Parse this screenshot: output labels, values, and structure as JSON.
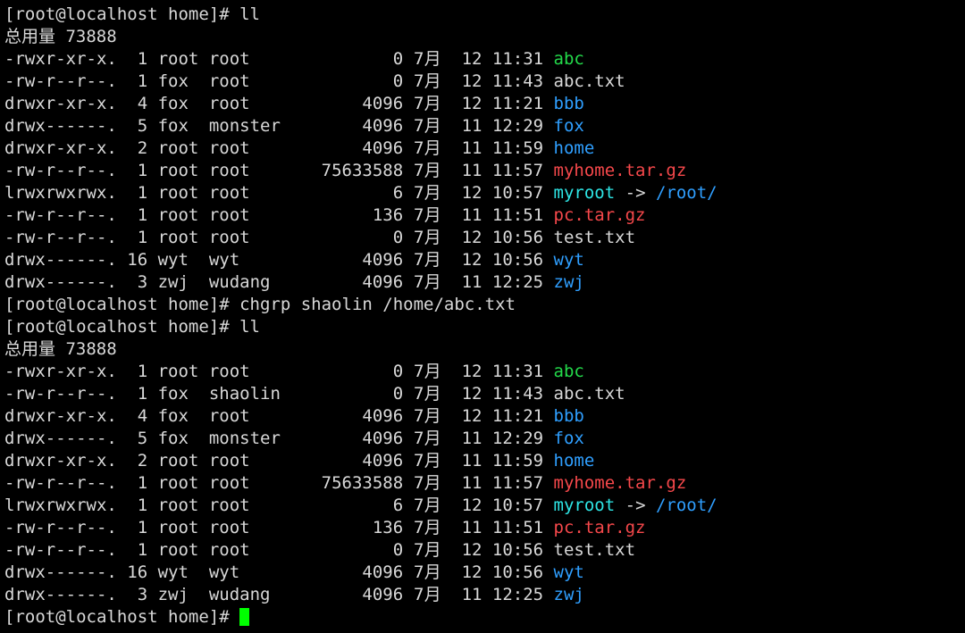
{
  "terminal": {
    "title": "root@localhost:/home",
    "background_color": "#000000",
    "foreground_color": "#d8d8d8",
    "font_size_px": 19,
    "line_height_px": 25,
    "cols": 88,
    "rows": 28,
    "colors": {
      "default": "#d8d8d8",
      "directory": "#2f9fff",
      "executable": "#23d94a",
      "archive": "#f6484b",
      "symlink": "#2ee6e6",
      "cursor": "#00ff00"
    },
    "prompt": "[root@localhost home]#",
    "total_label": "总用量",
    "total_value": "73888",
    "month_label": "7月",
    "link_arrow": "->",
    "commands": [
      "ll",
      "chgrp shaolin /home/abc.txt",
      "ll"
    ],
    "cursor_char": "block"
  },
  "listing_1": {
    "total_line": "总用量 73888",
    "rows": [
      {
        "perms": "-rwxr-xr-x.",
        "links": "1",
        "owner": "root",
        "group": "root",
        "size": "0",
        "month": "7月",
        "day": "12",
        "time": "11:31",
        "name": "abc",
        "color": "executable",
        "target": ""
      },
      {
        "perms": "-rw-r--r--.",
        "links": "1",
        "owner": "fox",
        "group": "root",
        "size": "0",
        "month": "7月",
        "day": "12",
        "time": "11:43",
        "name": "abc.txt",
        "color": "default",
        "target": ""
      },
      {
        "perms": "drwxr-xr-x.",
        "links": "4",
        "owner": "fox",
        "group": "root",
        "size": "4096",
        "month": "7月",
        "day": "12",
        "time": "11:21",
        "name": "bbb",
        "color": "directory",
        "target": ""
      },
      {
        "perms": "drwx------.",
        "links": "5",
        "owner": "fox",
        "group": "monster",
        "size": "4096",
        "month": "7月",
        "day": "11",
        "time": "12:29",
        "name": "fox",
        "color": "directory",
        "target": ""
      },
      {
        "perms": "drwxr-xr-x.",
        "links": "2",
        "owner": "root",
        "group": "root",
        "size": "4096",
        "month": "7月",
        "day": "11",
        "time": "11:59",
        "name": "home",
        "color": "directory",
        "target": ""
      },
      {
        "perms": "-rw-r--r--.",
        "links": "1",
        "owner": "root",
        "group": "root",
        "size": "75633588",
        "month": "7月",
        "day": "11",
        "time": "11:57",
        "name": "myhome.tar.gz",
        "color": "archive",
        "target": ""
      },
      {
        "perms": "lrwxrwxrwx.",
        "links": "1",
        "owner": "root",
        "group": "root",
        "size": "6",
        "month": "7月",
        "day": "12",
        "time": "10:57",
        "name": "myroot",
        "color": "symlink",
        "target": "/root/"
      },
      {
        "perms": "-rw-r--r--.",
        "links": "1",
        "owner": "root",
        "group": "root",
        "size": "136",
        "month": "7月",
        "day": "11",
        "time": "11:51",
        "name": "pc.tar.gz",
        "color": "archive",
        "target": ""
      },
      {
        "perms": "-rw-r--r--.",
        "links": "1",
        "owner": "root",
        "group": "root",
        "size": "0",
        "month": "7月",
        "day": "12",
        "time": "10:56",
        "name": "test.txt",
        "color": "default",
        "target": ""
      },
      {
        "perms": "drwx------.",
        "links": "16",
        "owner": "wyt",
        "group": "wyt",
        "size": "4096",
        "month": "7月",
        "day": "12",
        "time": "10:56",
        "name": "wyt",
        "color": "directory",
        "target": ""
      },
      {
        "perms": "drwx------.",
        "links": "3",
        "owner": "zwj",
        "group": "wudang",
        "size": "4096",
        "month": "7月",
        "day": "11",
        "time": "12:25",
        "name": "zwj",
        "color": "directory",
        "target": ""
      }
    ]
  },
  "listing_2": {
    "total_line": "总用量 73888",
    "rows": [
      {
        "perms": "-rwxr-xr-x.",
        "links": "1",
        "owner": "root",
        "group": "root",
        "size": "0",
        "month": "7月",
        "day": "12",
        "time": "11:31",
        "name": "abc",
        "color": "executable",
        "target": ""
      },
      {
        "perms": "-rw-r--r--.",
        "links": "1",
        "owner": "fox",
        "group": "shaolin",
        "size": "0",
        "month": "7月",
        "day": "12",
        "time": "11:43",
        "name": "abc.txt",
        "color": "default",
        "target": ""
      },
      {
        "perms": "drwxr-xr-x.",
        "links": "4",
        "owner": "fox",
        "group": "root",
        "size": "4096",
        "month": "7月",
        "day": "12",
        "time": "11:21",
        "name": "bbb",
        "color": "directory",
        "target": ""
      },
      {
        "perms": "drwx------.",
        "links": "5",
        "owner": "fox",
        "group": "monster",
        "size": "4096",
        "month": "7月",
        "day": "11",
        "time": "12:29",
        "name": "fox",
        "color": "directory",
        "target": ""
      },
      {
        "perms": "drwxr-xr-x.",
        "links": "2",
        "owner": "root",
        "group": "root",
        "size": "4096",
        "month": "7月",
        "day": "11",
        "time": "11:59",
        "name": "home",
        "color": "directory",
        "target": ""
      },
      {
        "perms": "-rw-r--r--.",
        "links": "1",
        "owner": "root",
        "group": "root",
        "size": "75633588",
        "month": "7月",
        "day": "11",
        "time": "11:57",
        "name": "myhome.tar.gz",
        "color": "archive",
        "target": ""
      },
      {
        "perms": "lrwxrwxrwx.",
        "links": "1",
        "owner": "root",
        "group": "root",
        "size": "6",
        "month": "7月",
        "day": "12",
        "time": "10:57",
        "name": "myroot",
        "color": "symlink",
        "target": "/root/"
      },
      {
        "perms": "-rw-r--r--.",
        "links": "1",
        "owner": "root",
        "group": "root",
        "size": "136",
        "month": "7月",
        "day": "11",
        "time": "11:51",
        "name": "pc.tar.gz",
        "color": "archive",
        "target": ""
      },
      {
        "perms": "-rw-r--r--.",
        "links": "1",
        "owner": "root",
        "group": "root",
        "size": "0",
        "month": "7月",
        "day": "12",
        "time": "10:56",
        "name": "test.txt",
        "color": "default",
        "target": ""
      },
      {
        "perms": "drwx------.",
        "links": "16",
        "owner": "wyt",
        "group": "wyt",
        "size": "4096",
        "month": "7月",
        "day": "12",
        "time": "10:56",
        "name": "wyt",
        "color": "directory",
        "target": ""
      },
      {
        "perms": "drwx------.",
        "links": "3",
        "owner": "zwj",
        "group": "wudang",
        "size": "4096",
        "month": "7月",
        "day": "11",
        "time": "12:25",
        "name": "zwj",
        "color": "directory",
        "target": ""
      }
    ]
  }
}
